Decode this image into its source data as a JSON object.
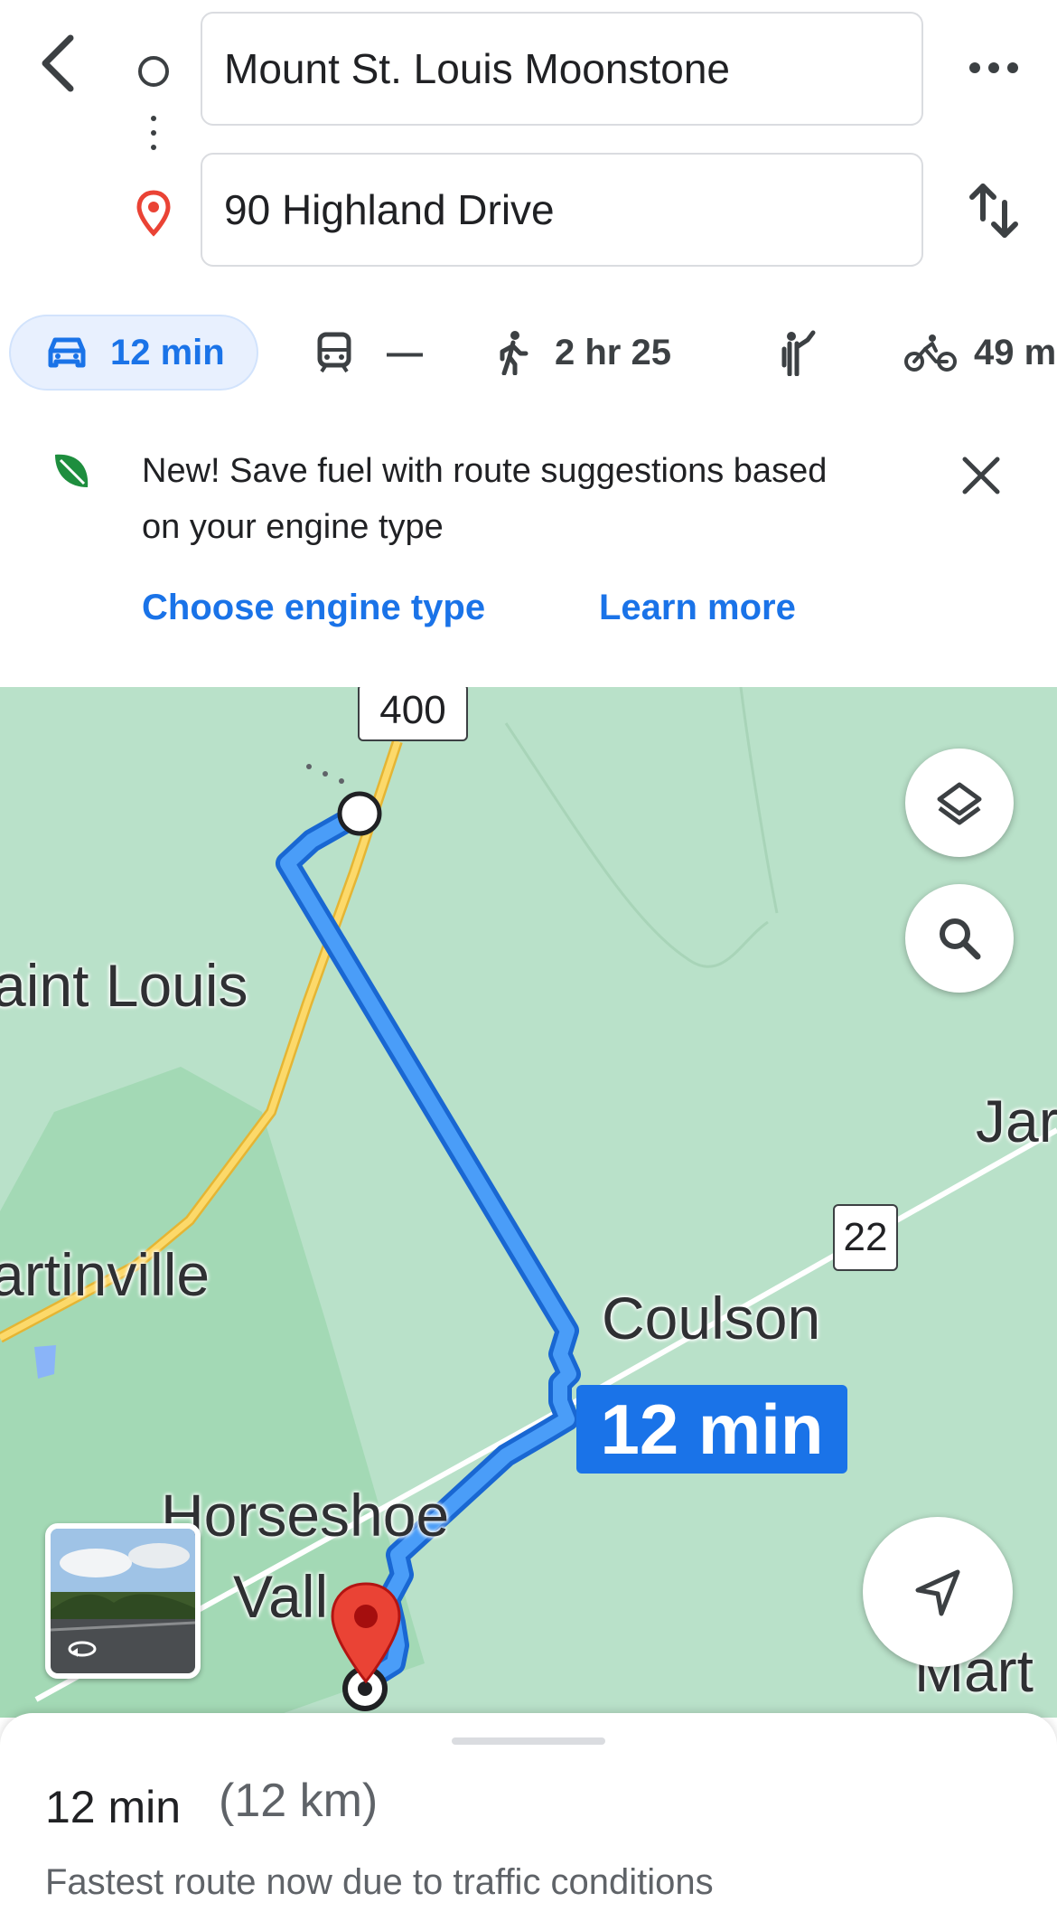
{
  "header": {
    "origin": "Mount St. Louis Moonstone",
    "destination": "90 Highland Drive"
  },
  "modes": {
    "drive": "12 min",
    "transit": "—",
    "walk": "2 hr 25",
    "bike": "49 m"
  },
  "banner": {
    "message": "New! Save fuel with route suggestions based on your engine type",
    "choose_engine": "Choose engine type",
    "learn_more": "Learn more"
  },
  "map": {
    "labels": {
      "saint_louis": "aint Louis",
      "martinville": "artinville",
      "coulson": "Coulson",
      "horseshoe": "Horseshoe",
      "valley": "Vall",
      "jar": "Jar",
      "mart": "Mart"
    },
    "highway_400": "400",
    "highway_22": "22",
    "eta": "12 min"
  },
  "sheet": {
    "duration": "12 min",
    "distance": "(12 km)",
    "description": "Fastest route now due to traffic conditions"
  },
  "colors": {
    "accent": "#1a73e8",
    "route": "#4a9df8",
    "map_bg": "#b9e1c9",
    "park": "#a3d9b5",
    "pin": "#ea4335"
  }
}
